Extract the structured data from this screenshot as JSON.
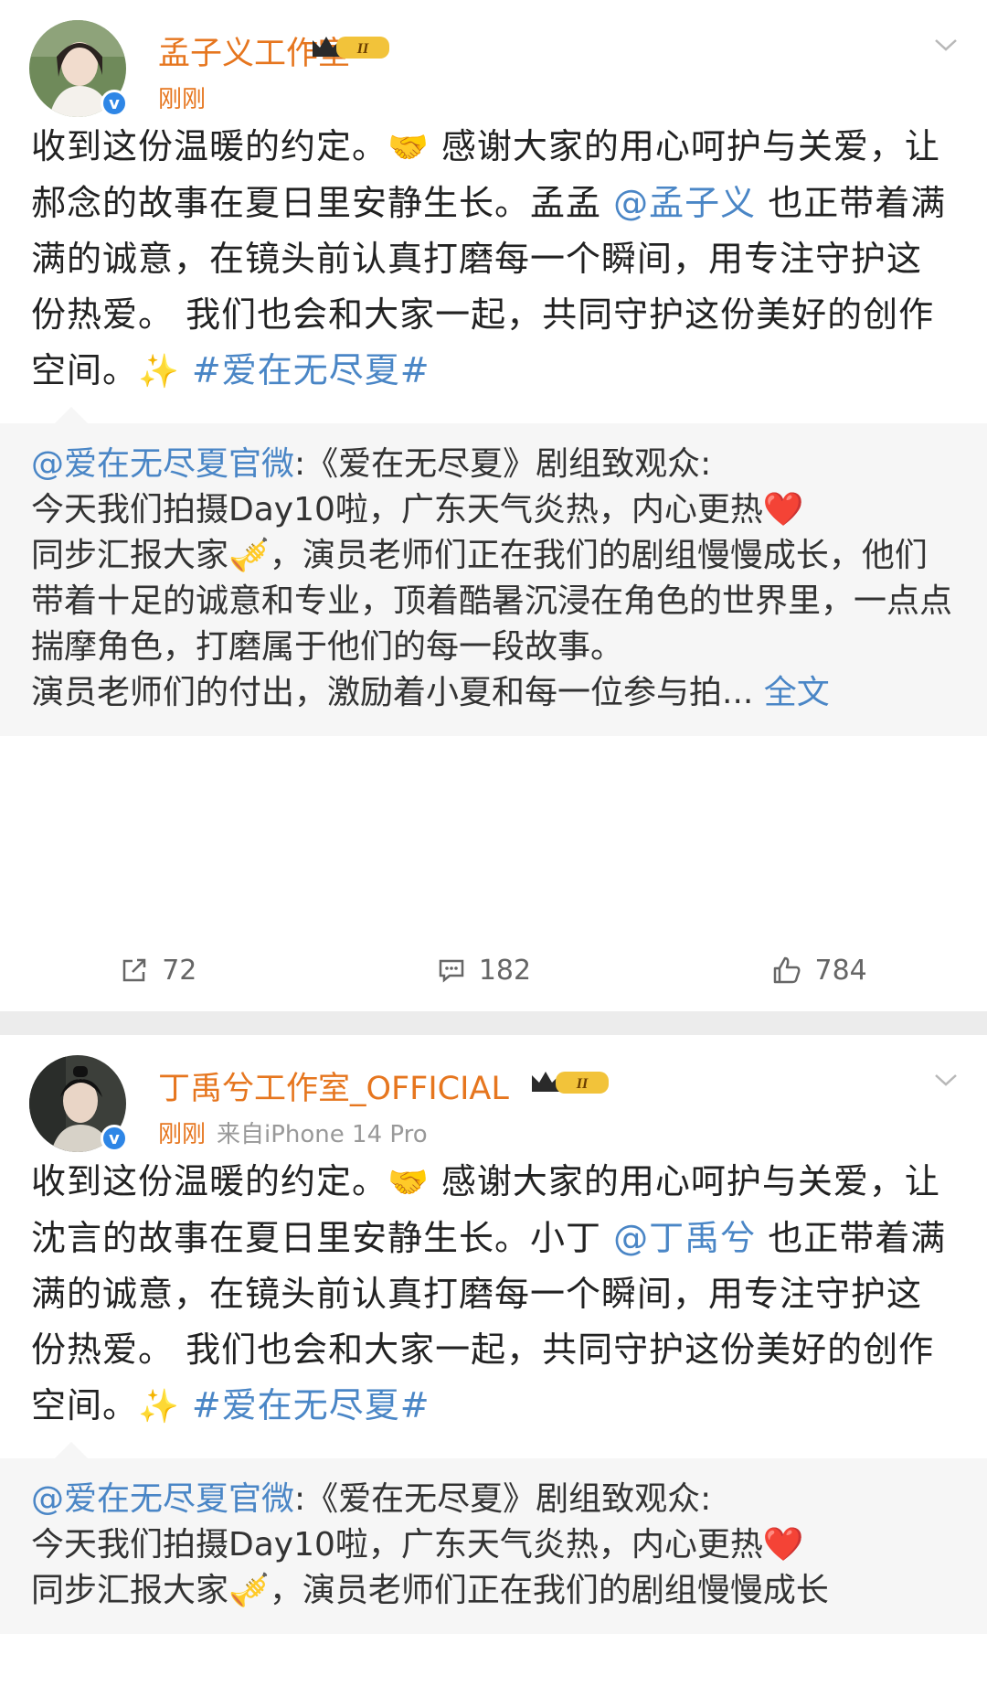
{
  "posts": [
    {
      "author": "孟子义工作室",
      "time": "刚刚",
      "source": "",
      "body": {
        "p1": "收到这份温暖的约定。",
        "e1": "🤝",
        "p2": " 感谢大家的用心呵护与关爱，让郝念的故事在夏日里安静生长。孟孟 ",
        "mention": "@孟子义",
        "p3": " 也正带着满满的诚意，在镜头前认真打磨每一个瞬间，用专注守护这份热爱。 我们也会和大家一起，共同守护这份美好的创作空间。",
        "e2": "✨",
        "tag": " #爱在无尽夏#"
      },
      "repost": {
        "author": "@爱在无尽夏官微",
        "line1": ":《爱在无尽夏》剧组致观众:",
        "line2": "今天我们拍摄Day10啦，广东天气炎热，内心更热",
        "heart": "❤️",
        "line3a": "同步汇报大家",
        "trumpet": "🎺",
        "line3b": "，演员老师们正在我们的剧组慢慢成长，他们带着十足的诚意和专业，顶着酷暑沉浸在角色的世界里，一点点揣摩角色，打磨属于他们的每一段故事。",
        "line4": "演员老师们的付出，激励着小夏和每一位参与拍...",
        "more": " 全文"
      },
      "actions": {
        "repost": "72",
        "comment": "182",
        "like": "784"
      }
    },
    {
      "author": "丁禹兮工作室_OFFICIAL",
      "time": "刚刚",
      "source": "来自iPhone 14 Pro",
      "body": {
        "p1": "收到这份温暖的约定。",
        "e1": "🤝",
        "p2": " 感谢大家的用心呵护与关爱，让沈言的故事在夏日里安静生长。小丁 ",
        "mention": "@丁禹兮",
        "p3": " 也正带着满满的诚意，在镜头前认真打磨每一个瞬间，用专注守护这份热爱。 我们也会和大家一起，共同守护这份美好的创作空间。",
        "e2": "✨",
        "tag": " #爱在无尽夏#"
      },
      "repost": {
        "author": "@爱在无尽夏官微",
        "line1": ":《爱在无尽夏》剧组致观众:",
        "line2": "今天我们拍摄Day10啦，广东天气炎热，内心更热",
        "heart": "❤️",
        "line3a": "同步汇报大家",
        "trumpet": "🎺",
        "line3b": "，演员老师们正在我们的剧组慢慢成长"
      }
    }
  ],
  "colors": {
    "name": "#e6761f",
    "link": "#4a86c6",
    "badge": "#2e86e6"
  }
}
